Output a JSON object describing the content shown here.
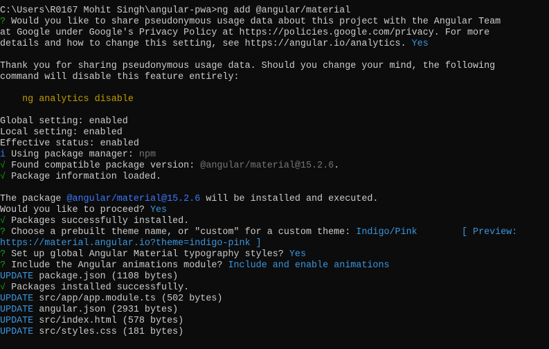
{
  "lines": [
    [
      {
        "t": "C:\\Users\\R0167 Mohit Singh\\angular-pwa>ng add @angular/material",
        "c": "default"
      }
    ],
    [
      {
        "t": "? ",
        "c": "green"
      },
      {
        "t": "Would you like to share pseudonymous usage data about this project with the Angular Team",
        "c": "default"
      }
    ],
    [
      {
        "t": "at Google under Google's Privacy Policy at https://policies.google.com/privacy. For more",
        "c": "default"
      }
    ],
    [
      {
        "t": "details and how to change this setting, see https://angular.io/analytics. ",
        "c": "default"
      },
      {
        "t": "Yes",
        "c": "cyan"
      }
    ],
    [],
    [
      {
        "t": "Thank you for sharing pseudonymous usage data. Should you change your mind, the following",
        "c": "default"
      }
    ],
    [
      {
        "t": "command will disable this feature entirely:",
        "c": "default"
      }
    ],
    [],
    [
      {
        "t": "    ng analytics disable",
        "c": "yellow"
      }
    ],
    [],
    [
      {
        "t": "Global setting: enabled",
        "c": "default"
      }
    ],
    [
      {
        "t": "Local setting: enabled",
        "c": "default"
      }
    ],
    [
      {
        "t": "Effective status: enabled",
        "c": "default"
      }
    ],
    [
      {
        "t": "i ",
        "c": "blue"
      },
      {
        "t": "Using package manager: ",
        "c": "default"
      },
      {
        "t": "npm",
        "c": "gray"
      }
    ],
    [
      {
        "t": "√ ",
        "c": "green"
      },
      {
        "t": "Found compatible package version: ",
        "c": "default"
      },
      {
        "t": "@angular/material@15.2.6",
        "c": "gray"
      },
      {
        "t": ".",
        "c": "default"
      }
    ],
    [
      {
        "t": "√ ",
        "c": "green"
      },
      {
        "t": "Package information loaded.",
        "c": "default"
      }
    ],
    [],
    [
      {
        "t": "The package ",
        "c": "default"
      },
      {
        "t": "@angular/material@15.2.6",
        "c": "blue"
      },
      {
        "t": " will be installed and executed.",
        "c": "default"
      }
    ],
    [
      {
        "t": "Would you like to proceed? ",
        "c": "default"
      },
      {
        "t": "Yes",
        "c": "cyan"
      }
    ],
    [
      {
        "t": "√ ",
        "c": "green"
      },
      {
        "t": "Packages successfully installed.",
        "c": "default"
      }
    ],
    [
      {
        "t": "? ",
        "c": "green"
      },
      {
        "t": "Choose a prebuilt theme name, or \"custom\" for a custom theme: ",
        "c": "default"
      },
      {
        "t": "Indigo/Pink        [ Preview:",
        "c": "cyan"
      }
    ],
    [
      {
        "t": "https://material.angular.io?theme=indigo-pink ]",
        "c": "cyan"
      }
    ],
    [
      {
        "t": "? ",
        "c": "green"
      },
      {
        "t": "Set up global Angular Material typography styles? ",
        "c": "default"
      },
      {
        "t": "Yes",
        "c": "cyan"
      }
    ],
    [
      {
        "t": "? ",
        "c": "green"
      },
      {
        "t": "Include the Angular animations module? ",
        "c": "default"
      },
      {
        "t": "Include and enable animations",
        "c": "cyan"
      }
    ],
    [
      {
        "t": "UPDATE",
        "c": "cyan"
      },
      {
        "t": " package.json (1108 bytes)",
        "c": "default"
      }
    ],
    [
      {
        "t": "√ ",
        "c": "green"
      },
      {
        "t": "Packages installed successfully.",
        "c": "default"
      }
    ],
    [
      {
        "t": "UPDATE",
        "c": "cyan"
      },
      {
        "t": " src/app/app.module.ts (502 bytes)",
        "c": "default"
      }
    ],
    [
      {
        "t": "UPDATE",
        "c": "cyan"
      },
      {
        "t": " angular.json (2931 bytes)",
        "c": "default"
      }
    ],
    [
      {
        "t": "UPDATE",
        "c": "cyan"
      },
      {
        "t": " src/index.html (578 bytes)",
        "c": "default"
      }
    ],
    [
      {
        "t": "UPDATE",
        "c": "cyan"
      },
      {
        "t": " src/styles.css (181 bytes)",
        "c": "default"
      }
    ]
  ],
  "colors": {
    "background": "#0c0c0c",
    "default": "#cccccc",
    "green": "#13a10e",
    "yellow": "#c19c00",
    "blue": "#3b78ff",
    "cyan": "#3a96dd",
    "gray": "#767676"
  }
}
